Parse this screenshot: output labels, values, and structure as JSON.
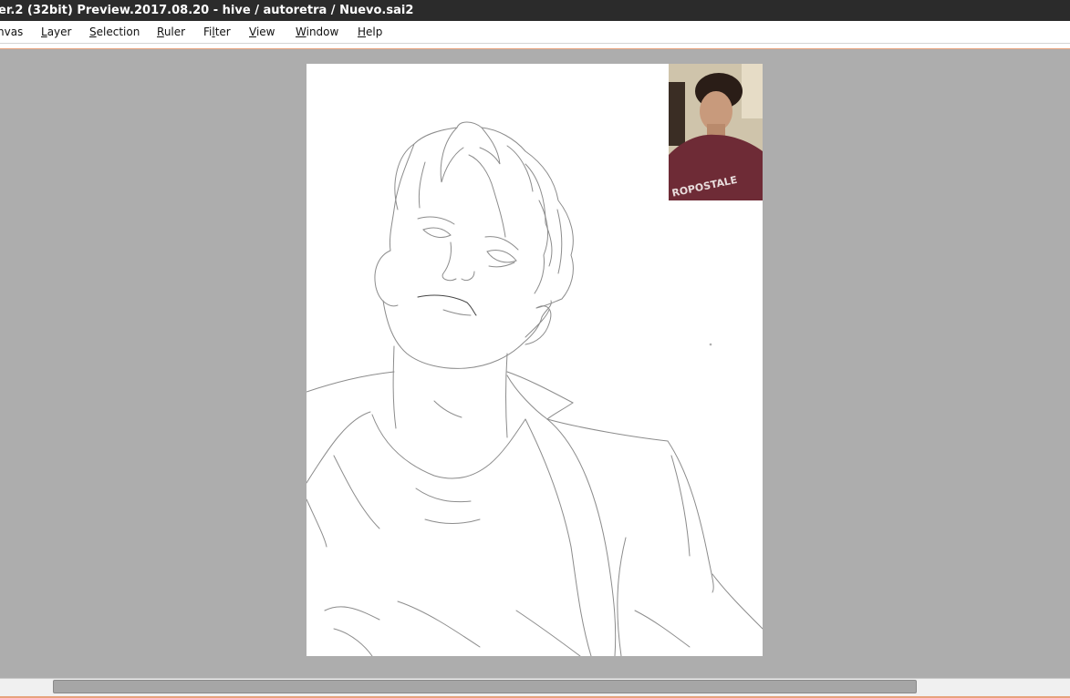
{
  "window": {
    "title": "er.2 (32bit) Preview.2017.08.20 - hive / autoretra / Nuevo.sai2"
  },
  "menu": {
    "items": [
      {
        "id": "canvas",
        "pre": "",
        "key": "",
        "post": "nvas"
      },
      {
        "id": "layer",
        "pre": "",
        "key": "L",
        "post": "ayer"
      },
      {
        "id": "selection",
        "pre": "",
        "key": "S",
        "post": "election"
      },
      {
        "id": "ruler",
        "pre": "",
        "key": "R",
        "post": "uler"
      },
      {
        "id": "filter",
        "pre": "Fi",
        "key": "l",
        "post": "ter"
      },
      {
        "id": "view",
        "pre": "",
        "key": "V",
        "post": "iew"
      },
      {
        "id": "window",
        "pre": "",
        "key": "W",
        "post": "indow"
      },
      {
        "id": "help",
        "pre": "",
        "key": "H",
        "post": "elp"
      }
    ]
  },
  "canvas": {
    "background": "#ffffff",
    "line_color": "#8a8a8a"
  },
  "webcam": {
    "shirt_text": "ROPOSTALE"
  },
  "colors": {
    "workspace": "#adadad",
    "titlebar": "#2b2b2b",
    "accent": "#e8a27c"
  }
}
